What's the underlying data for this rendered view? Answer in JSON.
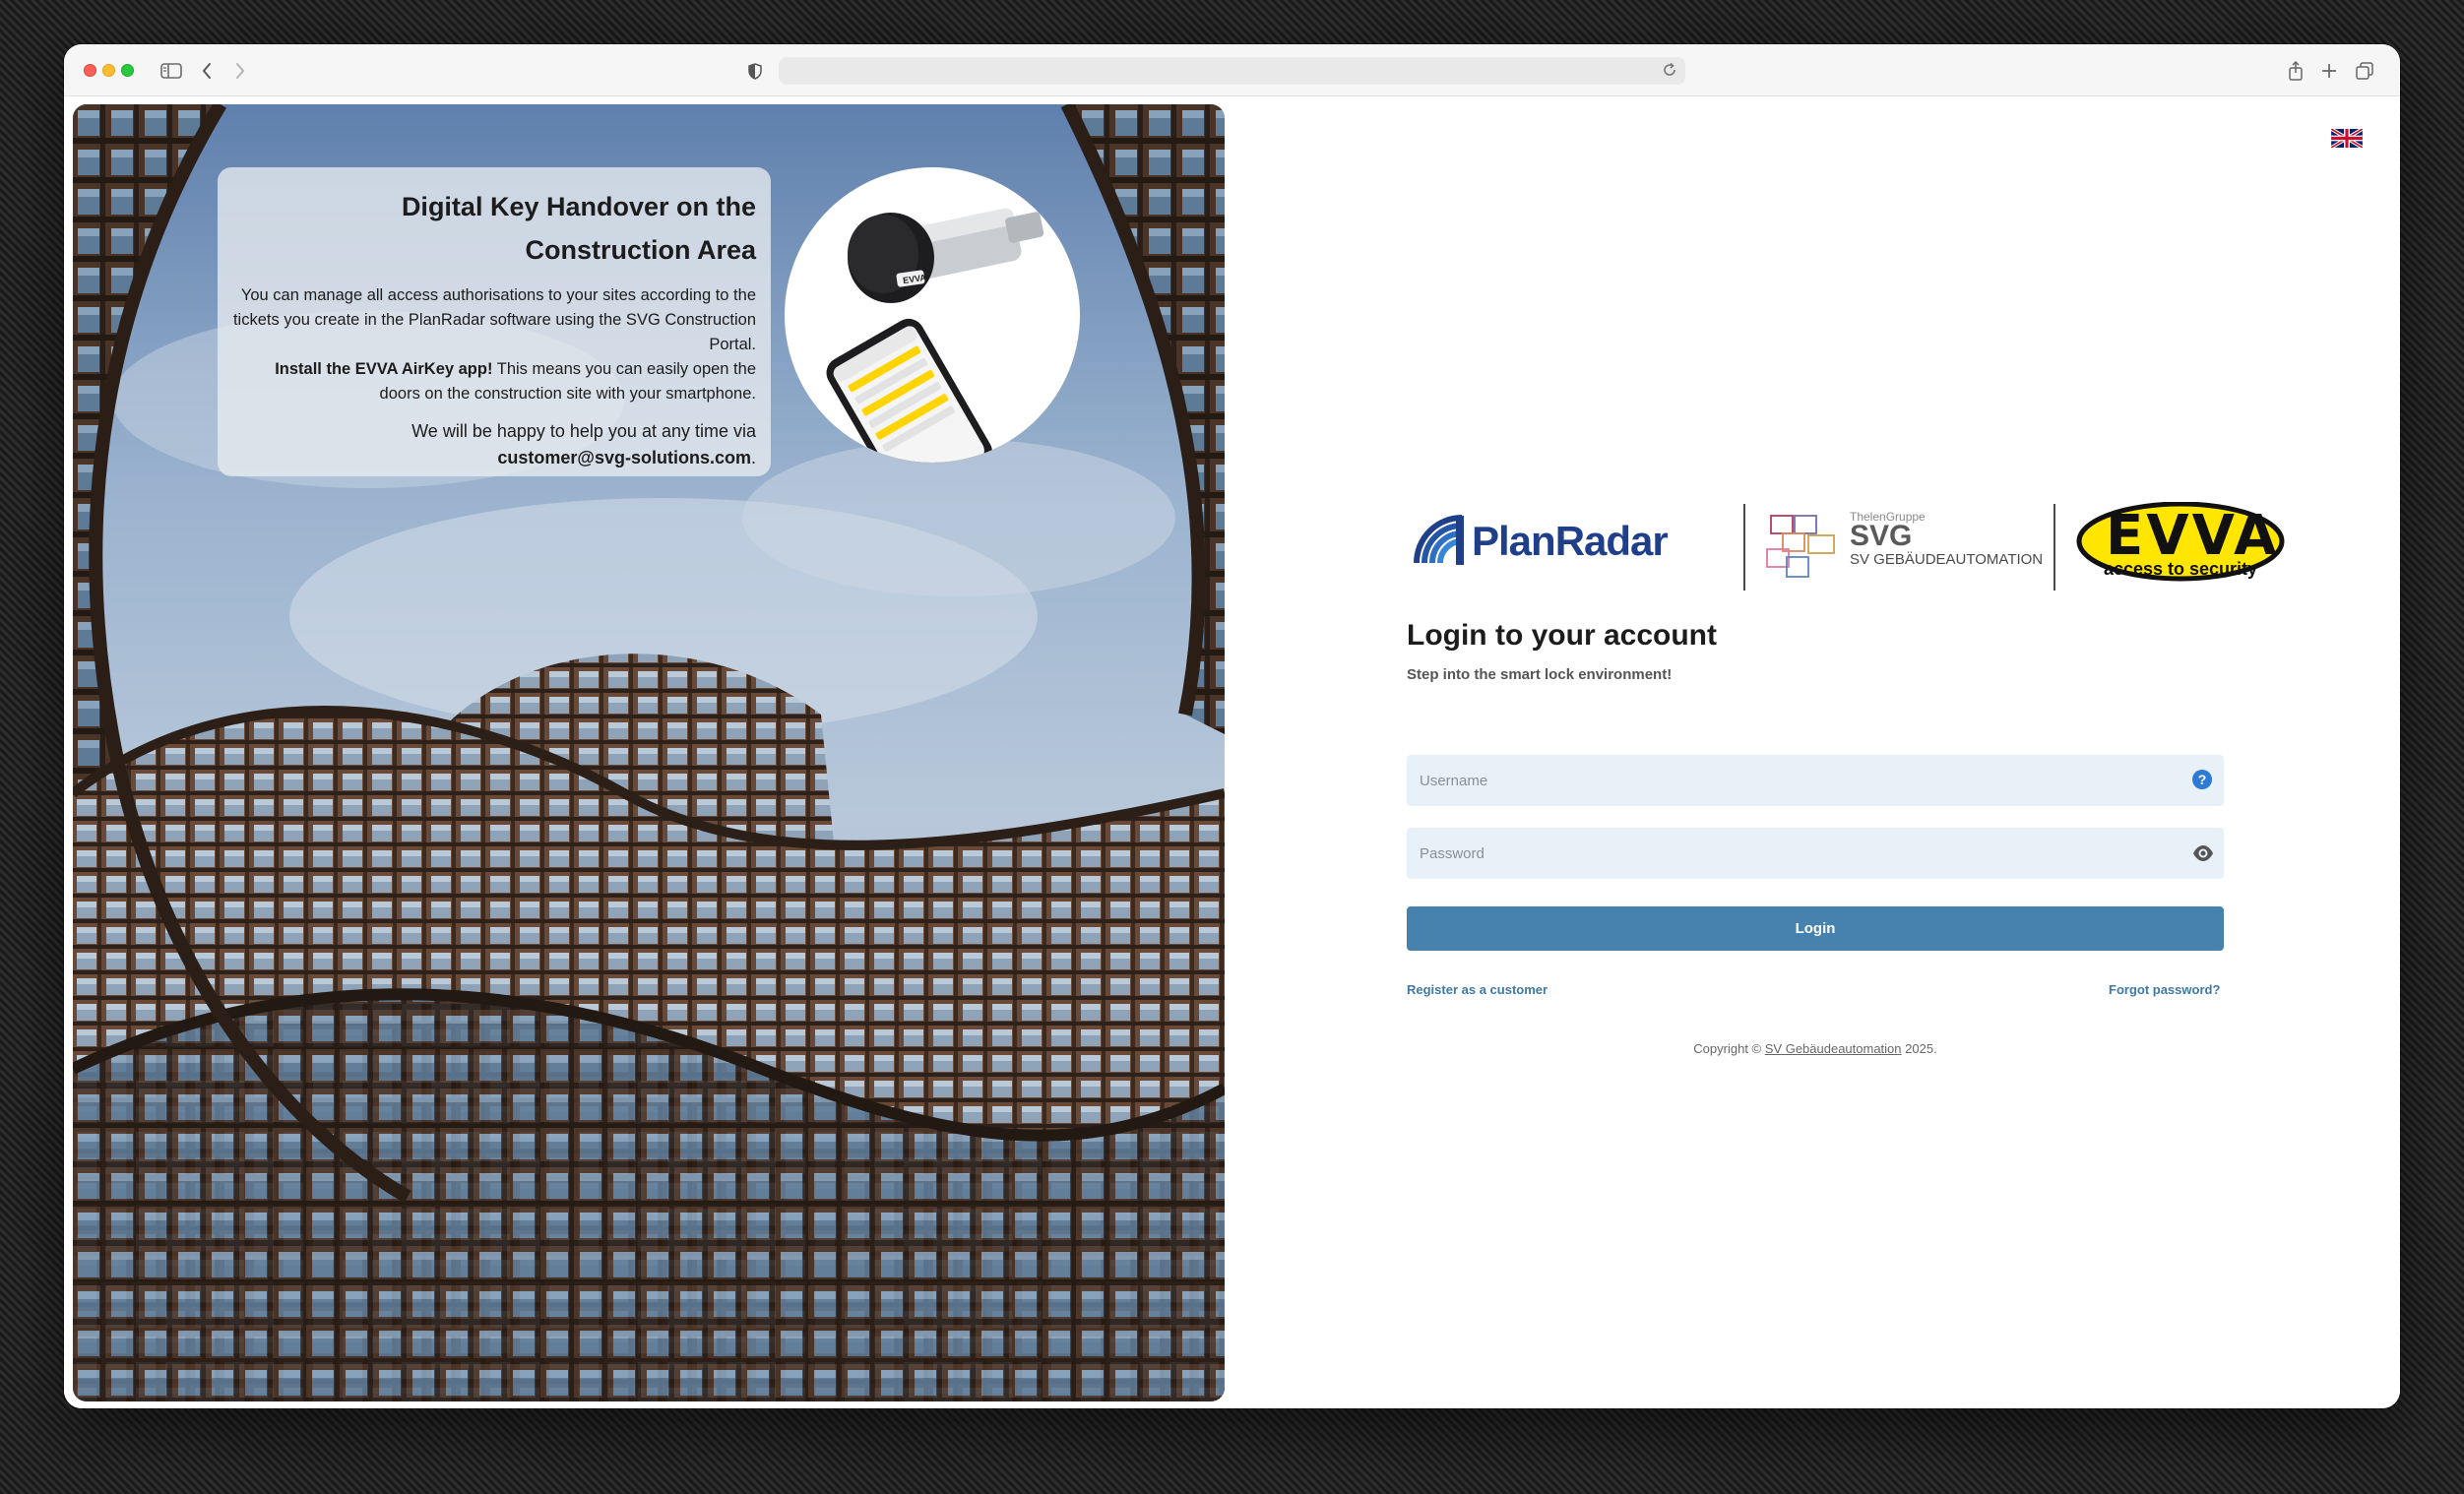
{
  "browser": {
    "url": ""
  },
  "hero": {
    "title": "Digital Key Handover on the Construction Area",
    "description": "You can manage all access authorisations to your sites according to the tickets you create in the PlanRadar software using the SVG Construction Portal.",
    "install_bold": "Install the EVVA AirKey app!",
    "install_rest": " This means you can easily open the doors on the construction site with your smartphone.",
    "help_text": "We will be happy to help you at any time via",
    "email": "customer@svg-solutions.com",
    "email_suffix": ".",
    "lock_brand": "EVVA"
  },
  "logos": {
    "planradar": "PlanRadar",
    "svg_group": "ThelenGruppe",
    "svg_name": "SVG",
    "svg_sub": "SV GEBÄUDEAUTOMATION",
    "evva_name": "EVVA",
    "evva_tagline": "access to security"
  },
  "login": {
    "title": "Login to your account",
    "subtitle": "Step into the smart lock environment!",
    "username_placeholder": "Username",
    "password_placeholder": "Password",
    "button_label": "Login",
    "register_link": "Register as a customer",
    "forgot_link": "Forgot password?"
  },
  "footer": {
    "prefix": "Copyright © ",
    "company": "SV Gebäudeautomation",
    "year": " 2025."
  },
  "colors": {
    "primary_button": "#4682ad",
    "link": "#3f79a6",
    "field_bg": "#e8f0f8",
    "evva_yellow": "#ffe600",
    "planradar_blue": "#1f3f8a"
  },
  "icons": {
    "language": "uk-flag-icon",
    "username_help": "help-circle-icon",
    "password_toggle": "eye-icon"
  }
}
